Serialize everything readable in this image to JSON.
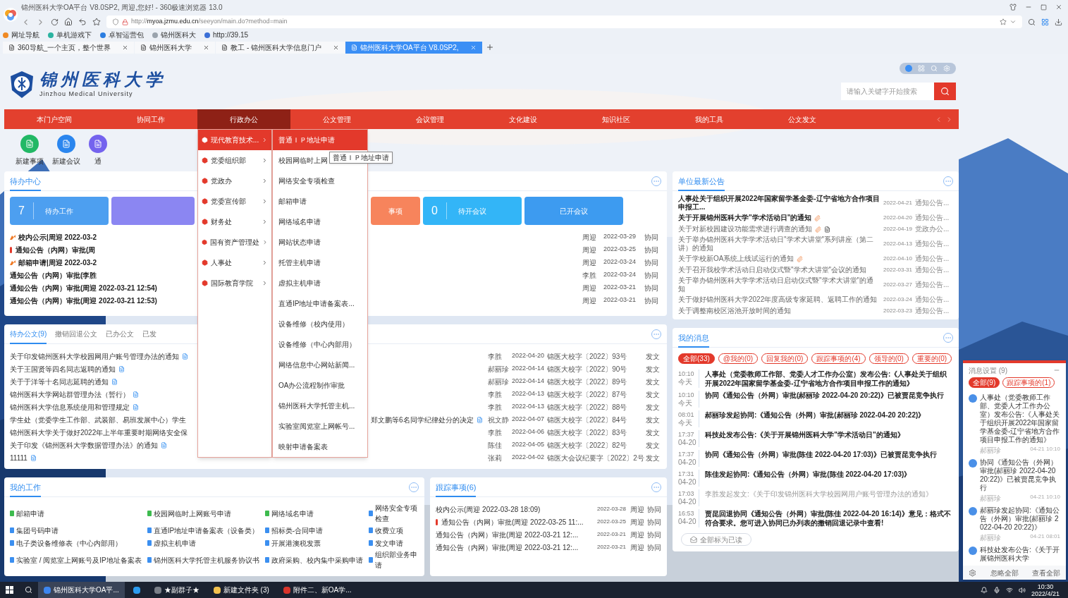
{
  "browser": {
    "title": "锦州医科大学OA平台 V8.0SP2, 周迎,您好! - 360极速浏览器 13.0",
    "url": {
      "scheme": "http://",
      "host": "myoa.jzmu.edu.cn",
      "path": "/seeyon/main.do?method=main"
    },
    "bookmarks": [
      {
        "label": "网址导航",
        "color": "#f08a24"
      },
      {
        "label": "单机游戏下",
        "color": "#2bb3a0"
      },
      {
        "label": "卓智运营包",
        "color": "#2a7de1"
      },
      {
        "label": "锦州医科大",
        "color": "#9aa3ad"
      },
      {
        "label": "http://39.15",
        "color": "#3b6fd6"
      }
    ],
    "tabs": [
      {
        "label": "360导航_一个主页，整个世界",
        "selected": false
      },
      {
        "label": "锦州医科大学",
        "selected": false
      },
      {
        "label": "教工 - 锦州医科大学信息门户",
        "selected": false
      },
      {
        "label": "锦州医科大学OA平台 V8.0SP2,",
        "selected": true
      }
    ]
  },
  "header": {
    "logo_cn": "锦州医科大学",
    "logo_en": "Jinzhou Medical University",
    "search_placeholder": "请输入关键字开始搜索"
  },
  "nav": [
    {
      "label": "本门户空间",
      "selected": false
    },
    {
      "label": "协同工作",
      "selected": false
    },
    {
      "label": "行政办公",
      "selected": true
    },
    {
      "label": "公文管理",
      "selected": false
    },
    {
      "label": "会议管理",
      "selected": false
    },
    {
      "label": "文化建设",
      "selected": false
    },
    {
      "label": "知识社区",
      "selected": false
    },
    {
      "label": "我的工具",
      "selected": false
    },
    {
      "label": "公文发文",
      "selected": false
    }
  ],
  "menu": {
    "groups": [
      {
        "label": "现代教育技术...",
        "selected": true
      },
      {
        "label": "党委组织部",
        "selected": false
      },
      {
        "label": "党政办",
        "selected": false
      },
      {
        "label": "党委宣传部",
        "selected": false
      },
      {
        "label": "财务处",
        "selected": false
      },
      {
        "label": "国有资产管理处",
        "selected": false
      },
      {
        "label": "人事处",
        "selected": false
      },
      {
        "label": "国际教育学院",
        "selected": false
      }
    ],
    "items": [
      {
        "label": "普通ＩＰ地址申请",
        "selected": true
      },
      {
        "label": "校园网临时上网",
        "selected": false
      },
      {
        "label": "网络安全专项检查",
        "selected": false
      },
      {
        "label": "邮箱申请",
        "selected": false
      },
      {
        "label": "网络域名申请",
        "selected": false
      },
      {
        "label": "网站状态申请",
        "selected": false
      },
      {
        "label": "托管主机申请",
        "selected": false
      },
      {
        "label": "虚拟主机申请",
        "selected": false
      },
      {
        "label": "直通IP地址申请备案表...",
        "selected": false
      },
      {
        "label": "设备维修（校内使用）",
        "selected": false
      },
      {
        "label": "设备维修（中心内部用）",
        "selected": false
      },
      {
        "label": "网络信息中心网站新闻...",
        "selected": false
      },
      {
        "label": "OA办公流程制作审批",
        "selected": false
      },
      {
        "label": "锦州医科大学托管主机...",
        "selected": false
      },
      {
        "label": "实验室阅览室上网帐号...",
        "selected": false
      },
      {
        "label": "映射申请备案表",
        "selected": false
      }
    ],
    "tooltip": "普通ＩＰ地址申请"
  },
  "shortcuts": [
    {
      "label": "新建事项",
      "color": "#22b865"
    },
    {
      "label": "新建会议",
      "color": "#2b86ee"
    },
    {
      "label": "通",
      "color": "#7463ee"
    }
  ],
  "todo": {
    "title": "待办中心",
    "cards": [
      {
        "kind": "count",
        "count": "7",
        "label": "待办工作",
        "color": "#4d9ff0"
      },
      {
        "kind": "blank",
        "color": "#8b86f2"
      },
      {
        "kind": "partial",
        "label": "事项",
        "color": "#f7845c"
      },
      {
        "kind": "count",
        "count": "0",
        "label": "待开会议",
        "color": "#33b5f7"
      },
      {
        "kind": "plain",
        "label": "已开会议",
        "color": "#3d9bf0"
      }
    ],
    "rows": [
      {
        "kind": "arrow",
        "text": "校内公示|周迎 2022-03-2",
        "person": "周迎",
        "date": "2022-03-29",
        "type": "协同"
      },
      {
        "kind": "alert",
        "text": "通知公告（内网）审批(周",
        "person": "周迎",
        "date": "2022-03-25",
        "type": "协同"
      },
      {
        "kind": "arrow",
        "text": "邮箱申请|周迎 2022-03-2",
        "person": "周迎",
        "date": "2022-03-24",
        "type": "协同"
      },
      {
        "text": "通知公告（内网）审批(李胜",
        "person": "李胜",
        "date": "2022-03-24",
        "type": "协同"
      },
      {
        "text": "通知公告（内网）审批(周迎 2022-03-21 12:54)",
        "person": "周迎",
        "date": "2022-03-21",
        "type": "协同"
      },
      {
        "text": "通知公告（内网）审批(周迎 2022-03-21 12:53)",
        "person": "周迎",
        "date": "2022-03-21",
        "type": "协同"
      }
    ]
  },
  "docs": {
    "tabs": [
      {
        "label": "待办公文(9)",
        "selected": true
      },
      {
        "label": "撤销回退公文",
        "selected": false
      },
      {
        "label": "已办公文",
        "selected": false
      },
      {
        "label": "已发",
        "selected": false
      }
    ],
    "rows": [
      {
        "title": "关于印发锦州医科大学校园网用户账号管理办法的通知",
        "file": true,
        "person": "李胜",
        "date": "2022-04-20",
        "number": "锦医大校字〔2022〕93号",
        "type": "发文"
      },
      {
        "title": "关于王国贤等四名同志返聘的通知",
        "file": true,
        "person": "郝丽珍",
        "date": "2022-04-14",
        "number": "锦医大校字〔2022〕90号",
        "type": "发文"
      },
      {
        "title": "关于于洋等十名同志延聘的通知",
        "file": true,
        "person": "郝丽珍",
        "date": "2022-04-14",
        "number": "锦医大校字〔2022〕89号",
        "type": "发文"
      },
      {
        "title": "锦州医科大学网站群管理办法（暂行）",
        "file": true,
        "person": "李胜",
        "date": "2022-04-13",
        "number": "锦医大校字〔2022〕87号",
        "type": "发文"
      },
      {
        "title": "锦州医科大学信息系统使用和管理规定",
        "file": true,
        "person": "李胜",
        "date": "2022-04-13",
        "number": "锦医大校字〔2022〕88号",
        "type": "发文"
      },
      {
        "title": "学生处（党委学生工作部、武装部、易班发展中心）学生",
        "tail": "郑文鹏等6名同学纪律处分的决定",
        "file": true,
        "person": "祝文静",
        "date": "2022-04-07",
        "number": "锦医大校字〔2022〕84号",
        "type": "发文"
      },
      {
        "title": "锦州医科大学关于做好2022年上半年重要时期网络安全保",
        "file": false,
        "person": "李胜",
        "date": "2022-04-06",
        "number": "锦医大校字〔2022〕83号",
        "type": "发文"
      },
      {
        "title": "关于印发《锦州医科大学数据管理办法》的通知",
        "file": true,
        "person": "陈佳",
        "date": "2022-04-05",
        "number": "锦医大校字〔2022〕82号",
        "type": "发文"
      },
      {
        "title": "11111",
        "file": true,
        "person": "张莉",
        "date": "2022-04-02",
        "number": "锦医大会议纪要字〔2022〕2号",
        "type": "发文"
      }
    ]
  },
  "work": {
    "title": "我的工作",
    "items": [
      {
        "label": "邮箱申请",
        "color": "#3dbb4e"
      },
      {
        "label": "校园网临时上网账号申请",
        "color": "#3dbb4e"
      },
      {
        "label": "网络域名申请",
        "color": "#3dbb4e"
      },
      {
        "label": "网络安全专项检查",
        "color": "#3b8ff0"
      },
      {
        "label": "集团号码申请",
        "color": "#3b8ff0"
      },
      {
        "label": "直通IP地址申请备案表（设备类）",
        "color": "#3b8ff0"
      },
      {
        "label": "招标类-合同申请",
        "color": "#3b8ff0"
      },
      {
        "label": "收费立项",
        "color": "#3b8ff0"
      },
      {
        "label": "电子类设备维修表（中心内部用）",
        "color": "#3b8ff0"
      },
      {
        "label": "虚拟主机申请",
        "color": "#3b8ff0"
      },
      {
        "label": "开展港澳税发票",
        "color": "#3b8ff0"
      },
      {
        "label": "发文申请",
        "color": "#3b8ff0"
      },
      {
        "label": "实验室 / 阅览室上网账号及IP地址备案表",
        "color": "#3b8ff0"
      },
      {
        "label": "锦州医科大学托管主机服务协议书",
        "color": "#3b8ff0"
      },
      {
        "label": "政府采购、校内集中采购申请",
        "color": "#3b8ff0"
      },
      {
        "label": "组织部业务申请",
        "color": "#3b8ff0"
      }
    ]
  },
  "tracking": {
    "title": "跟踪事项(6)",
    "rows": [
      {
        "text": "校内公示(周迎 2022-03-28 18:09)",
        "date": "2022-03-28",
        "person": "周迎",
        "type": "协同"
      },
      {
        "kind": "alert",
        "text": "通知公告（内网）审批(周迎 2022-03-25 11:...",
        "date": "2022-03-25",
        "person": "周迎",
        "type": "协同"
      },
      {
        "text": "通知公告（内网）审批(周迎 2022-03-21 12:...",
        "date": "2022-03-21",
        "person": "周迎",
        "type": "协同"
      },
      {
        "text": "通知公告（内网）审批(周迎 2022-03-21 12:...",
        "date": "2022-03-21",
        "person": "周迎",
        "type": "协同"
      }
    ]
  },
  "notices": {
    "title": "单位最新公告",
    "rows": [
      {
        "title": "人事处关于组织开展2022年国家留学基金委-辽宁省地方合作项目申报工...",
        "date": "2022-04-21",
        "type": "通知公告...",
        "unread": true
      },
      {
        "title": "关于开展锦州医科大学\"学术活动日\"的通知",
        "clip": true,
        "date": "2022-04-20",
        "type": "通知公告...",
        "unread": true
      },
      {
        "title": "关于对新校园建设功能需求进行调查的通知",
        "clip": true,
        "doc": true,
        "date": "2022-04-19",
        "type": "党政办公...",
        "unread": false
      },
      {
        "title": "关于举办锦州医科大学学术活动日\"学术大讲堂\"系列讲座（第二讲）的通知",
        "date": "2022-04-13",
        "type": "通知公告...",
        "unread": false
      },
      {
        "title": "关于学校新OA系统上线试运行的通知",
        "clip": true,
        "date": "2022-04-10",
        "type": "通知公告...",
        "unread": false
      },
      {
        "title": "关于召开我校学术活动日启动仪式暨\"学术大讲堂\"会议的通知",
        "date": "2022-03-31",
        "type": "通知公告...",
        "unread": false
      },
      {
        "title": "关于举办锦州医科大学学术活动日启动仪式暨\"学术大讲堂\"的通知",
        "date": "2022-03-27",
        "type": "通知公告...",
        "unread": false
      },
      {
        "title": "关于做好锦州医科大学2022年度高级专家延聘、返聘工作的通知",
        "date": "2022-03-24",
        "type": "通知公告...",
        "unread": false
      },
      {
        "title": "关于调整南校区浴池开放时间的通知",
        "date": "2022-03-23",
        "type": "通知公告...",
        "unread": false
      }
    ]
  },
  "messages": {
    "title": "我的消息",
    "filters": [
      {
        "label": "全部(33)",
        "selected": true
      },
      {
        "label": "@我的(0)",
        "selected": false
      },
      {
        "label": "回复我的(0)",
        "selected": false
      },
      {
        "label": "跟踪事项的(4)",
        "selected": false
      },
      {
        "label": "领导的(0)",
        "selected": false
      },
      {
        "label": "重要的(0)",
        "selected": false
      }
    ],
    "items": [
      {
        "time": "10:10",
        "day": "今天",
        "text": "人事处（党委教师工作部、党委人才工作办公室）发布公告:《人事处关于组织开展2022年国家留学基金委-辽宁省地方合作项目申报工作的通知》",
        "read": false
      },
      {
        "time": "10:10",
        "day": "今天",
        "text": "协同《通知公告（外网）审批(郝丽珍 2022-04-20 20:22)》已被贾昆竞争执行",
        "read": false
      },
      {
        "time": "08:01",
        "day": "今天",
        "text": "郝丽珍发起协同:《通知公告（外网）审批(郝丽珍 2022-04-20 20:22)》",
        "read": false
      },
      {
        "time": "17:37",
        "day": "04-20",
        "text": "科技处发布公告:《关于开展锦州医科大学\"学术活动日\"的通知》",
        "read": false
      },
      {
        "time": "17:37",
        "day": "04-20",
        "text": "协同《通知公告（外网）审批(陈佳 2022-04-20 17:03)》已被贾昆竞争执行",
        "read": false
      },
      {
        "time": "17:31",
        "day": "04-20",
        "text": "陈佳发起协同:《通知公告（外网）审批(陈佳 2022-04-20 17:03)》",
        "read": false
      },
      {
        "time": "17:03",
        "day": "04-20",
        "text": "李胜发起发文:《关于印发锦州医科大学校园网用户账号管理办法的通知》",
        "read": true
      },
      {
        "time": "16:53",
        "day": "04-20",
        "text": "贾昆回退协同《通知公告（外网）审批(陈佳 2022-04-20 16:14)》意见：格式不符合要求。您可进入协同已办列表的撤销回退记录中查看!",
        "read": false
      }
    ],
    "mark_all": "全部标为已读"
  },
  "popup": {
    "title": "消息设置",
    "count": "(9)",
    "filters": [
      {
        "label": "全部(9)",
        "selected": true
      },
      {
        "label": "跟踪事项的(1)",
        "selected": false
      }
    ],
    "items": [
      {
        "text": "人事处（党委教师工作部、党委人才工作办公室）发布公告:《人事处关于组织开展2022年国家留学基金委-辽宁省地方合作项目申报工作的通知》",
        "sender": "郝丽珍",
        "time": "04-21 10:10"
      },
      {
        "text": "协同《通知公告（外网）审批(郝丽珍 2022-04-20 20:22)》已被贾昆竞争执行",
        "sender": "郝丽珍",
        "time": "04-21 10:10"
      },
      {
        "text": "郝丽珍发起协同:《通知公告（外网）审批(郝丽珍 2022-04-20 20:22)》",
        "sender": "郝丽珍",
        "time": "04-21 08:01"
      },
      {
        "text": "科技处发布公告:《关于开展锦州医科大学"
      }
    ],
    "ignore_all": "忽略全部",
    "view_all": "查看全部"
  },
  "taskbar": {
    "apps": [
      {
        "label": "锦州医科大学OA平...",
        "selected": true,
        "color": "#3d86f0"
      },
      {
        "color": "#2b9cf0",
        "selected": false
      },
      {
        "label": "★副群子★",
        "color": "#7a7f88",
        "selected": false
      },
      {
        "label": "新建文件夹 (3)",
        "color": "#f2c14e",
        "selected": false
      },
      {
        "label": "附件二、新OA学...",
        "color": "#d9342b",
        "selected": false
      }
    ],
    "time": "10:30",
    "date": "2022/4/21"
  }
}
